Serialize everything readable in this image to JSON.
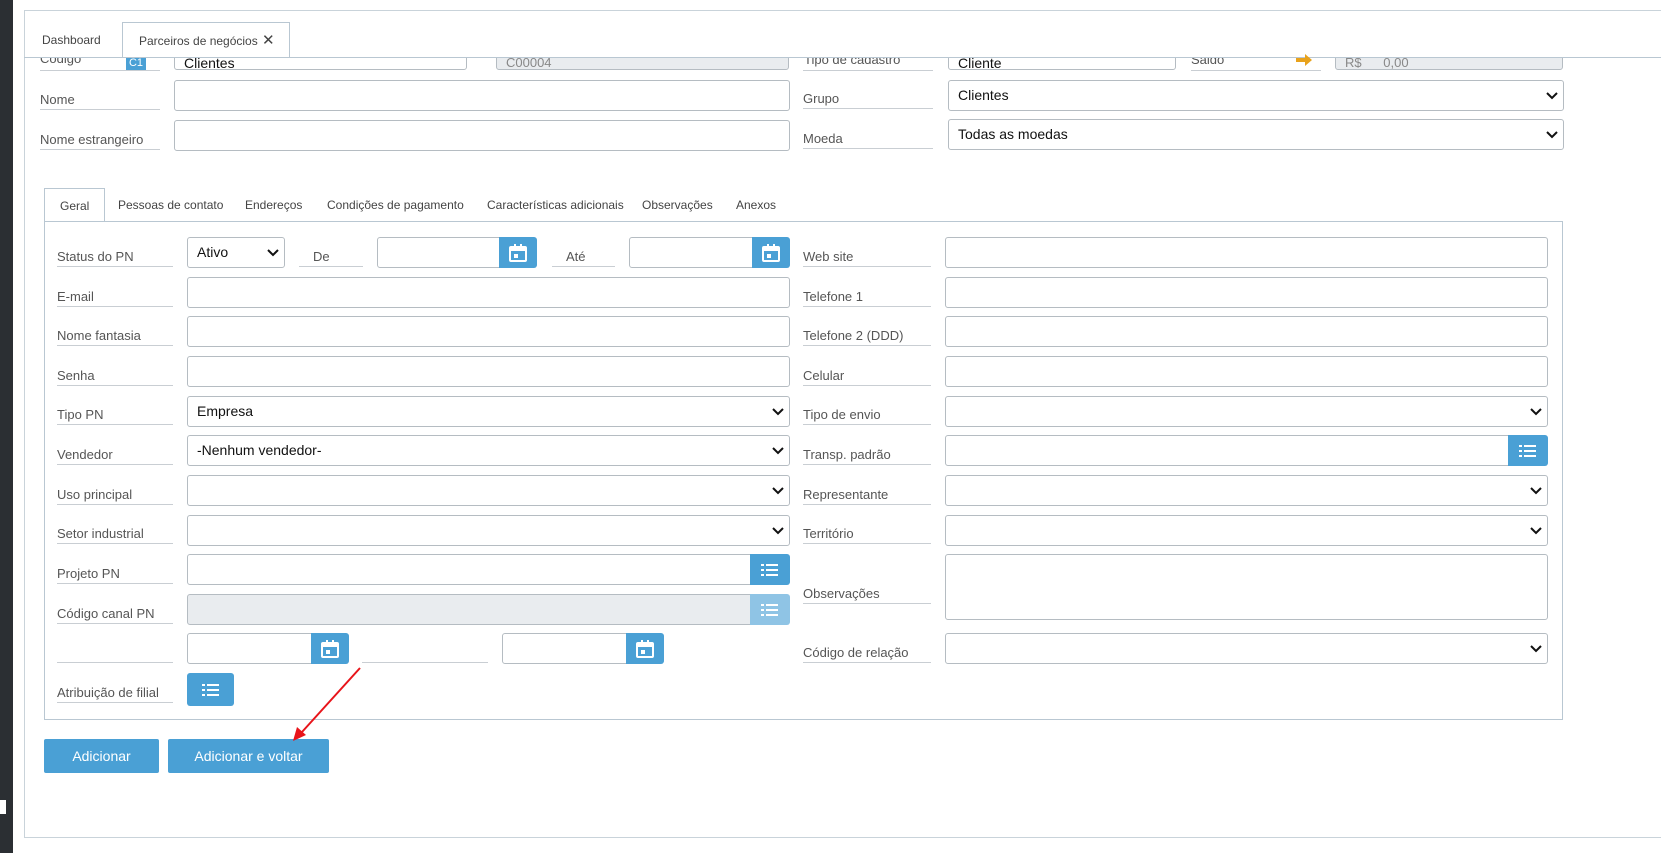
{
  "tabs": {
    "dashboard": "Dashboard",
    "partners": "Parceiros de negócios"
  },
  "header": {
    "codigo_label": "Código",
    "codigo_badge": "C1",
    "serie_value": "Clientes",
    "codigo_value": "C00004",
    "tipo_cadastro_label": "Tipo de cadastro",
    "tipo_cadastro_value": "Cliente",
    "saldo_label": "Saldo",
    "saldo_currency": "R$",
    "saldo_value": "0,00",
    "nome_label": "Nome",
    "nome_value": "",
    "nome_estrangeiro_label": "Nome estrangeiro",
    "nome_estrangeiro_value": "",
    "grupo_label": "Grupo",
    "grupo_value": "Clientes",
    "moeda_label": "Moeda",
    "moeda_value": "Todas as moedas"
  },
  "inner_tabs": [
    "Geral",
    "Pessoas de contato",
    "Endereços",
    "Condições de pagamento",
    "Características adicionais",
    "Observações",
    "Anexos"
  ],
  "geral": {
    "status_label": "Status do PN",
    "status_value": "Ativo",
    "de_label": "De",
    "ate_label": "Até",
    "email_label": "E-mail",
    "nome_fantasia_label": "Nome fantasia",
    "senha_label": "Senha",
    "tipo_pn_label": "Tipo PN",
    "tipo_pn_value": "Empresa",
    "vendedor_label": "Vendedor",
    "vendedor_value": "-Nenhum vendedor-",
    "uso_principal_label": "Uso principal",
    "setor_industrial_label": "Setor industrial",
    "projeto_pn_label": "Projeto PN",
    "codigo_canal_label": "Código canal PN",
    "atribuicao_filial_label": "Atribuição de filial",
    "web_site_label": "Web site",
    "telefone1_label": "Telefone 1",
    "telefone2_label": "Telefone 2 (DDD)",
    "celular_label": "Celular",
    "tipo_envio_label": "Tipo de envio",
    "transp_padrao_label": "Transp. padrão",
    "representante_label": "Representante",
    "territorio_label": "Território",
    "observacoes_label": "Observações",
    "codigo_relacao_label": "Código de relação"
  },
  "actions": {
    "add": "Adicionar",
    "add_and_back": "Adicionar e voltar"
  },
  "colors": {
    "accent": "#4aa0d5",
    "arrow": "#e8141a",
    "saldo_arrow": "#e8a21c"
  }
}
